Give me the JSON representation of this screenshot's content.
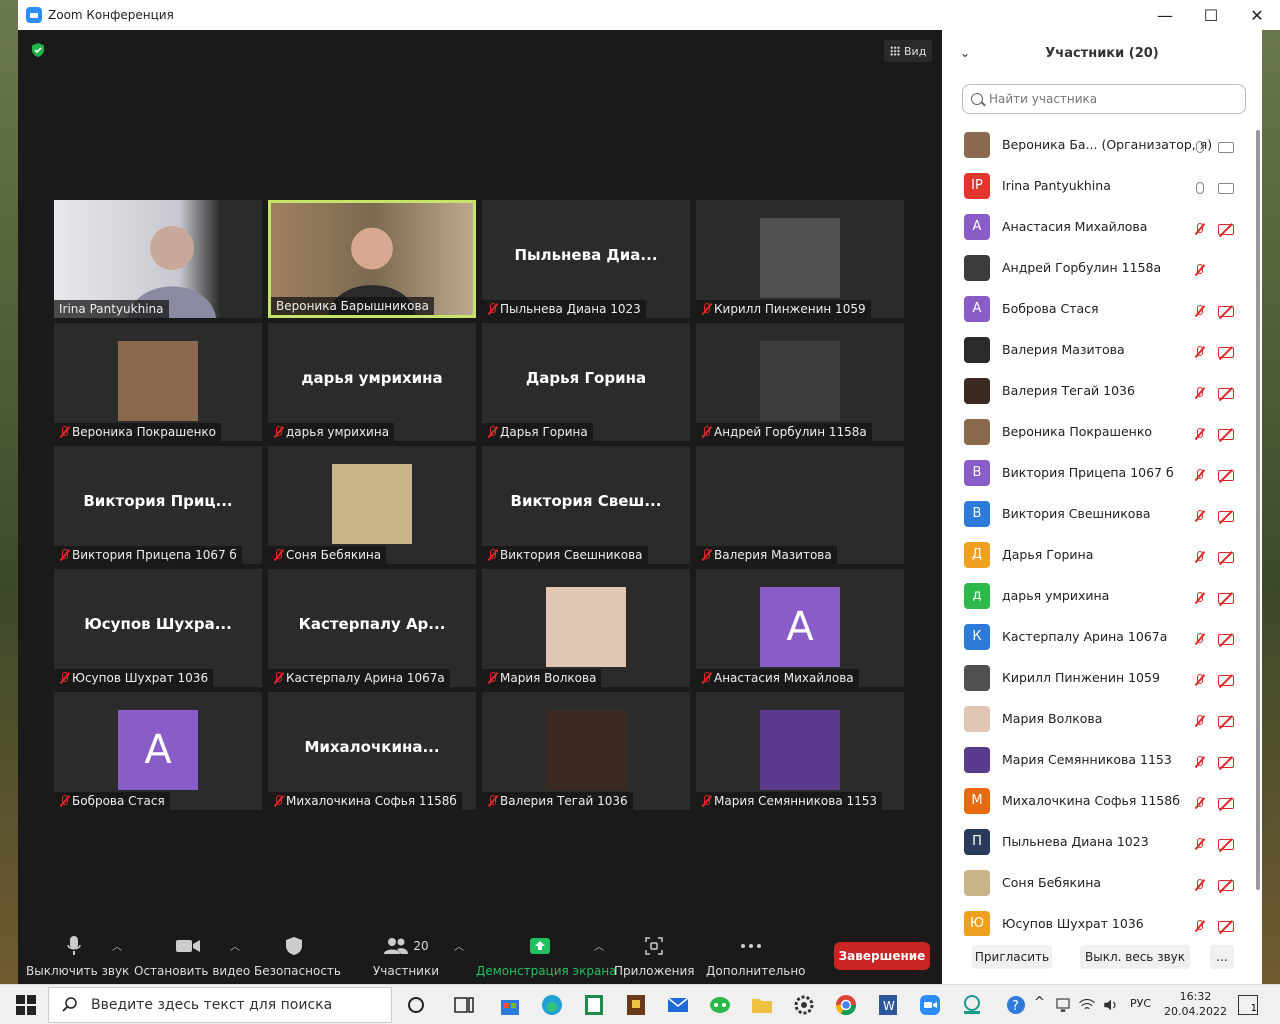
{
  "window": {
    "title": "Zoom Конференция",
    "min": "—",
    "max": "☐",
    "close": "✕"
  },
  "view_button": "Вид",
  "tiles": [
    {
      "title": "",
      "label": "Irina Pantyukhina",
      "muted": false,
      "kind": "video",
      "active": false
    },
    {
      "title": "",
      "label": "Вероника Барышникова",
      "muted": false,
      "kind": "video",
      "active": true
    },
    {
      "title": "Пыльнева  Диа...",
      "label": "Пыльнева Диана 1023",
      "muted": true,
      "kind": "name"
    },
    {
      "title": "",
      "label": "Кирилл Пинженин 1059",
      "muted": true,
      "kind": "photo",
      "color": "#505050"
    },
    {
      "title": "",
      "label": "Вероника Покрашенко",
      "muted": true,
      "kind": "photo",
      "color": "#8a6a4c"
    },
    {
      "title": "дарья умрихина",
      "label": "дарья умрихина",
      "muted": true,
      "kind": "name"
    },
    {
      "title": "Дарья Горина",
      "label": "Дарья Горина",
      "muted": true,
      "kind": "name"
    },
    {
      "title": "",
      "label": "Андрей Горбулин 1158а",
      "muted": true,
      "kind": "photo",
      "color": "#3c3c3c"
    },
    {
      "title": "Виктория  Приц...",
      "label": "Виктория Прицепа 1067 б",
      "muted": true,
      "kind": "name"
    },
    {
      "title": "",
      "label": "Соня Бебякина",
      "muted": true,
      "kind": "photo",
      "color": "#c8b488"
    },
    {
      "title": "Виктория  Свеш...",
      "label": "Виктория Свешникова",
      "muted": true,
      "kind": "name"
    },
    {
      "title": "",
      "label": "Валерия Мазитова",
      "muted": true,
      "kind": "photo",
      "color": "#2a2a2a"
    },
    {
      "title": "Юсупов  Шухра...",
      "label": "Юсупов Шухрат 1036",
      "muted": true,
      "kind": "name"
    },
    {
      "title": "Кастерпалу  Ар...",
      "label": "Кастерпалу Арина 1067а",
      "muted": true,
      "kind": "name"
    },
    {
      "title": "",
      "label": "Мария Волкова",
      "muted": true,
      "kind": "photo",
      "color": "#e2c6b4"
    },
    {
      "title": "",
      "label": "Анастасия Михайлова",
      "muted": true,
      "kind": "avatar",
      "letter": "A"
    },
    {
      "title": "",
      "label": "Боброва Стася",
      "muted": true,
      "kind": "avatar",
      "letter": "A"
    },
    {
      "title": "Михалочкина...",
      "label": "Михалочкина Софья 1158б",
      "muted": true,
      "kind": "name"
    },
    {
      "title": "",
      "label": "Валерия Тегай 1036",
      "muted": true,
      "kind": "photo",
      "color": "#3a2a22"
    },
    {
      "title": "",
      "label": "Мария Семянникова 1153",
      "muted": true,
      "kind": "photo",
      "color": "#5a3a8a"
    }
  ],
  "toolbar": {
    "mute": "Выключить звук",
    "video": "Остановить видео",
    "security": "Безопасность",
    "participants": "Участники",
    "participants_count": "20",
    "share": "Демонстрация экрана",
    "apps": "Приложения",
    "more": "Дополнительно",
    "end": "Завершение"
  },
  "panel": {
    "title": "Участники (20)",
    "search_placeholder": "Найти участника",
    "invite": "Пригласить",
    "mute_all": "Выкл. весь звук",
    "more": "...",
    "participants": [
      {
        "name": "Вероника Ба...  (Организатор, я)",
        "av": "",
        "color": "#8a6a50",
        "mic": "on",
        "cam": "on"
      },
      {
        "name": "Irina Pantyukhina",
        "av": "IP",
        "color": "#e0362e",
        "mic": "on",
        "cam": "on"
      },
      {
        "name": "Анастасия Михайлова",
        "av": "А",
        "color": "#8a5cc7",
        "mic": "off",
        "cam": "off"
      },
      {
        "name": "Андрей Горбулин 1158а",
        "av": "",
        "color": "#3c3c3c",
        "mic": "off",
        "cam": "none"
      },
      {
        "name": "Боброва Стася",
        "av": "А",
        "color": "#8a5cc7",
        "mic": "off",
        "cam": "off"
      },
      {
        "name": "Валерия Мазитова",
        "av": "",
        "color": "#2a2a2a",
        "mic": "off",
        "cam": "off"
      },
      {
        "name": "Валерия Тегай 1036",
        "av": "",
        "color": "#3a2a22",
        "mic": "off",
        "cam": "off"
      },
      {
        "name": "Вероника Покрашенко",
        "av": "",
        "color": "#8a6a4c",
        "mic": "off",
        "cam": "off"
      },
      {
        "name": "Виктория Прицепа 1067 б",
        "av": "В",
        "color": "#8a5cc7",
        "mic": "off",
        "cam": "off"
      },
      {
        "name": "Виктория Свешникова",
        "av": "В",
        "color": "#2d7ad8",
        "mic": "off",
        "cam": "off"
      },
      {
        "name": "Дарья Горина",
        "av": "Д",
        "color": "#f0a020",
        "mic": "off",
        "cam": "off"
      },
      {
        "name": "дарья умрихина",
        "av": "д",
        "color": "#2cb84a",
        "mic": "off",
        "cam": "off"
      },
      {
        "name": "Кастерпалу Арина 1067а",
        "av": "К",
        "color": "#2d7ad8",
        "mic": "off",
        "cam": "off"
      },
      {
        "name": "Кирилл Пинженин 1059",
        "av": "",
        "color": "#505050",
        "mic": "off",
        "cam": "off"
      },
      {
        "name": "Мария Волкова",
        "av": "",
        "color": "#e2c6b4",
        "mic": "off",
        "cam": "off"
      },
      {
        "name": "Мария Семянникова 1153",
        "av": "",
        "color": "#5a3a8a",
        "mic": "off",
        "cam": "off"
      },
      {
        "name": "Михалочкина Софья 1158б",
        "av": "М",
        "color": "#e86a10",
        "mic": "off",
        "cam": "off"
      },
      {
        "name": "Пыльнева Диана 1023",
        "av": "П",
        "color": "#2a3a5a",
        "mic": "off",
        "cam": "off"
      },
      {
        "name": "Соня Бебякина",
        "av": "",
        "color": "#c8b488",
        "mic": "off",
        "cam": "off"
      },
      {
        "name": "Юсупов Шухрат 1036",
        "av": "Ю",
        "color": "#f0a020",
        "mic": "off",
        "cam": "off"
      }
    ]
  },
  "taskbar": {
    "search_placeholder": "Введите здесь текст для поиска",
    "lang": "РУС",
    "time": "16:32",
    "date": "20.04.2022",
    "notifications": "1"
  }
}
